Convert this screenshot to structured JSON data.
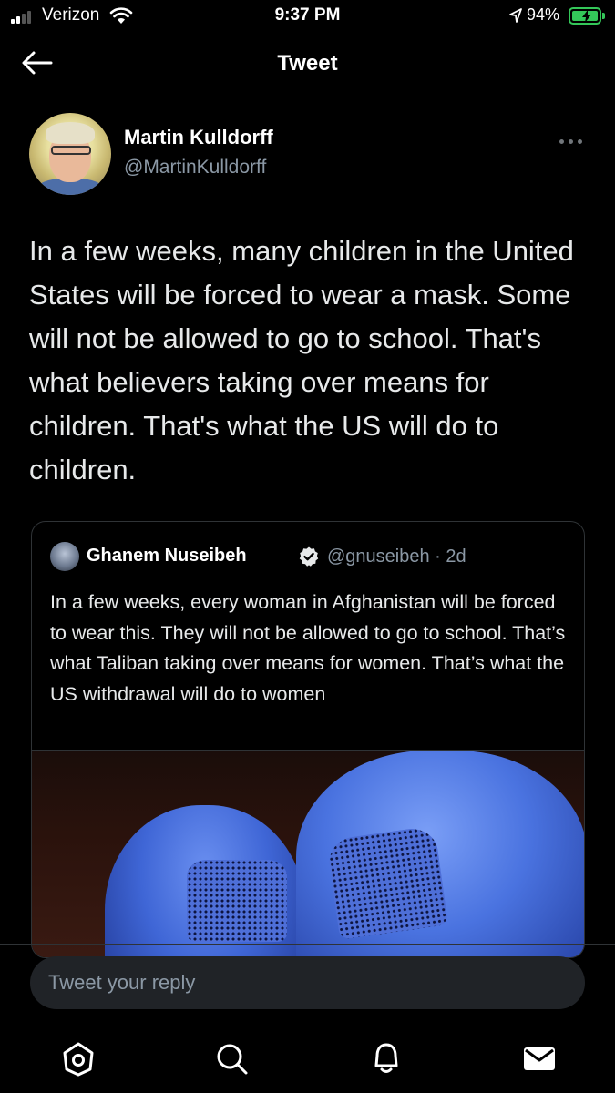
{
  "status_bar": {
    "carrier": "Verizon",
    "time": "9:37 PM",
    "battery_percent": "94%"
  },
  "header": {
    "title": "Tweet",
    "back_icon": "arrow-left-icon"
  },
  "tweet": {
    "author_name": "Martin Kulldorff",
    "author_handle": "@MartinKulldorff",
    "text": "In a few weeks, many children in the United States will be forced to wear a mask. Some will not be allowed to go to school. That's what believers taking over means for children. That's what the US will do to children."
  },
  "quoted_tweet": {
    "author_name": "Ghanem Nuseibeh",
    "author_handle": "@gnuseibeh · 2d",
    "verified": true,
    "text": "In a few weeks, every woman in Afghanistan will be forced to wear this. They will not be allowed to go to school. That’s what Taliban taking over means for women. That’s what the US withdrawal will do to women"
  },
  "reply": {
    "placeholder": "Tweet your reply"
  },
  "nav": {
    "items": [
      "home-icon",
      "search-icon",
      "bell-icon",
      "mail-icon"
    ]
  },
  "colors": {
    "background": "#000000",
    "text": "#e7e9ea",
    "secondary": "#8b98a5",
    "verified": "#e7e9ea",
    "battery": "#34c759"
  }
}
